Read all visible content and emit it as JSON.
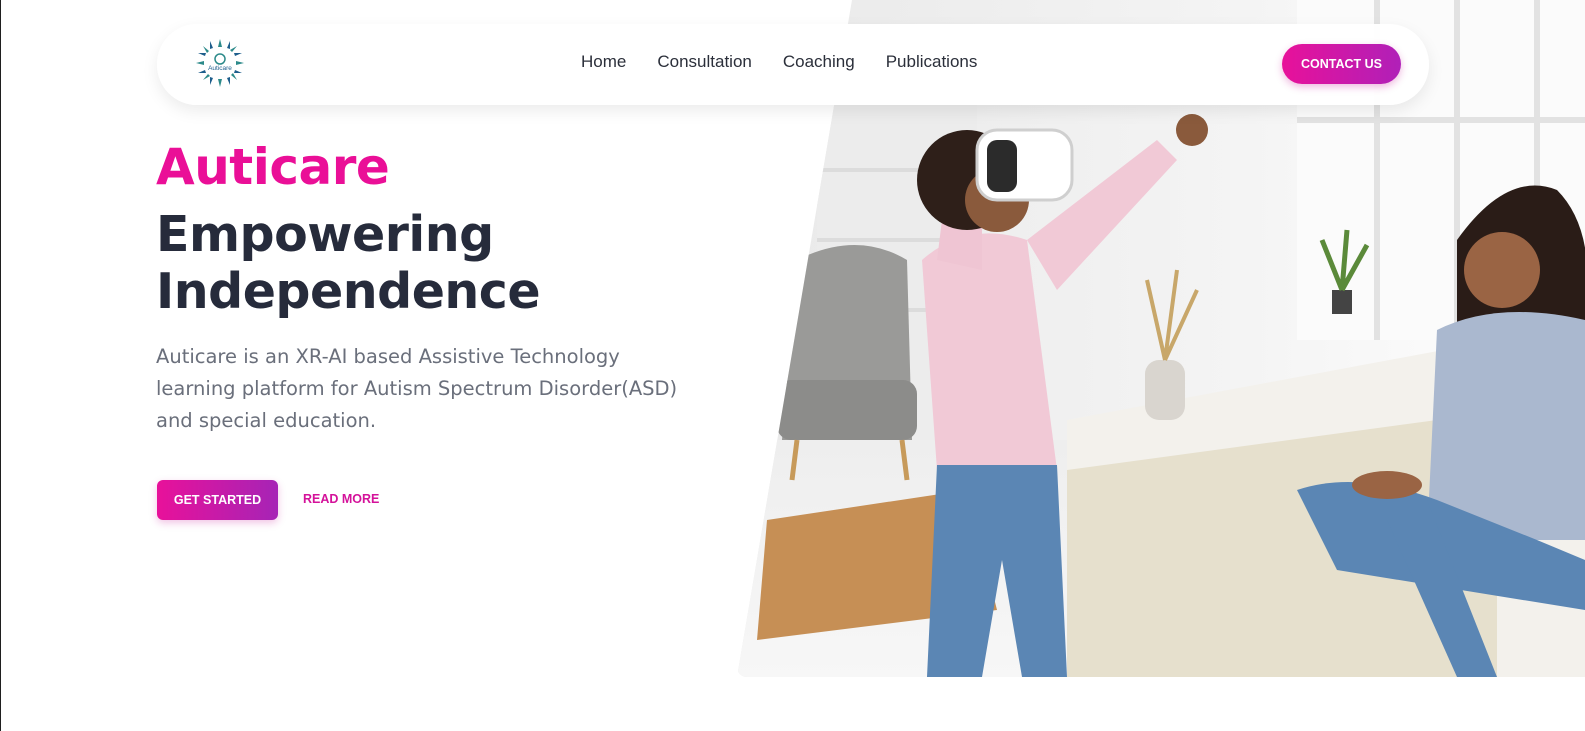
{
  "header": {
    "logo_label": "Auticare",
    "nav": [
      {
        "label": "Home"
      },
      {
        "label": "Consultation"
      },
      {
        "label": "Coaching"
      },
      {
        "label": "Publications"
      }
    ],
    "contact_label": "CONTACT US"
  },
  "hero": {
    "title": "Auticare",
    "headline_line1": "Empowering",
    "headline_line2": "Independence",
    "description": "Auticare is an XR-AI based Assistive Technology learning platform for Autism Spectrum Disorder(ASD) and special education.",
    "primary_cta": "GET STARTED",
    "secondary_cta": "READ MORE",
    "image_alt": "Child wearing a VR headset with a smiling woman sitting on a bed"
  },
  "colors": {
    "brand_pink": "#ea0f97",
    "brand_purple": "#b020b8",
    "heading": "#262b3b",
    "body_text": "#6a6f7b"
  }
}
